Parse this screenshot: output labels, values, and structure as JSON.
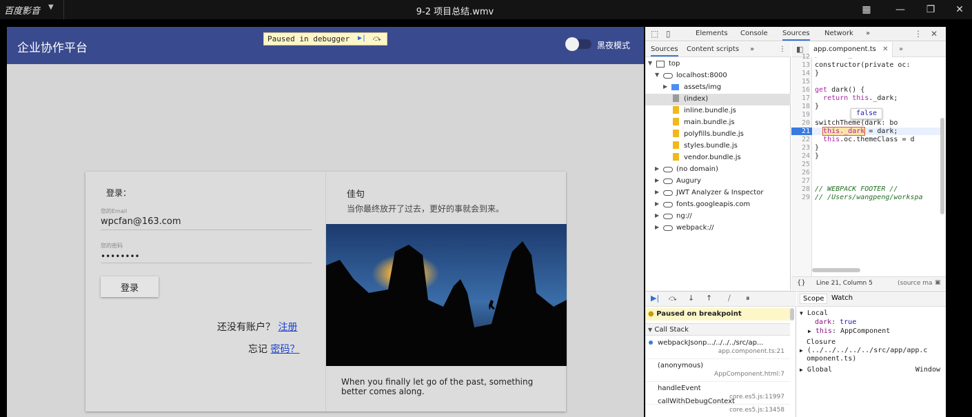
{
  "player": {
    "app_name": "百度影音",
    "video_title": "9-2 项目总结.wmv"
  },
  "app": {
    "title": "企业协作平台",
    "dark_mode_label": "黑夜模式",
    "debugger_banner": "Paused in debugger",
    "login": {
      "title": "登录：",
      "email_label": "您的Email",
      "email_value": "wpcfan@163.com",
      "password_label": "您的密码",
      "password_value": "••••••••",
      "login_button": "登录",
      "no_account_text": "还没有账户？",
      "register_link": "注册",
      "forgot_text": "忘记",
      "password_link": "密码？"
    },
    "quote": {
      "title": "佳句",
      "chinese": "当你最终放开了过去，更好的事就会到来。",
      "english": "When you finally let go of the past, something better comes along."
    }
  },
  "devtools": {
    "tabs": [
      "Elements",
      "Console",
      "Sources",
      "Network"
    ],
    "more": "»",
    "nav_tabs": [
      "Sources",
      "Content scripts"
    ],
    "tree": [
      {
        "label": "top"
      },
      {
        "label": "localhost:8000"
      },
      {
        "label": "assets/img"
      },
      {
        "label": "(index)"
      },
      {
        "label": "inline.bundle.js"
      },
      {
        "label": "main.bundle.js"
      },
      {
        "label": "polyfills.bundle.js"
      },
      {
        "label": "styles.bundle.js"
      },
      {
        "label": "vendor.bundle.js"
      },
      {
        "label": "(no domain)"
      },
      {
        "label": "Augury"
      },
      {
        "label": "JWT Analyzer & Inspector"
      },
      {
        "label": "fonts.googleapis.com"
      },
      {
        "label": "ng://"
      },
      {
        "label": "webpack://"
      }
    ],
    "editor_tab": "app.component.ts",
    "line_numbers": [
      "12",
      "13",
      "14",
      "15",
      "16",
      "17",
      "18",
      "19",
      "20",
      "21",
      "22",
      "23",
      "24",
      "25",
      "26",
      "27",
      "28",
      "29"
    ],
    "tooltip_value": "false",
    "status": "Line 21, Column 5",
    "status_right": "(source ma",
    "paused_on_breakpoint": "Paused on breakpoint",
    "call_stack_header": "Call Stack",
    "call_stack": [
      {
        "fn": "webpackJsonp.../../../../src/ap...",
        "loc": "app.component.ts:21"
      },
      {
        "fn": "(anonymous)",
        "loc": "AppComponent.html:7"
      },
      {
        "fn": "handleEvent",
        "loc": "core.es5.js:11997"
      },
      {
        "fn": "callWithDebugContext",
        "loc": "core.es5.js:13458"
      }
    ],
    "scope_tabs": [
      "Scope",
      "Watch"
    ],
    "scope": {
      "local": "Local",
      "dark_key": "dark",
      "dark_value": "true",
      "this_key": "this",
      "this_value": "AppComponent",
      "closure": "Closure",
      "closure_path_1": "(../../../../../src/app/app.c",
      "closure_path_2": "omponent.ts)",
      "global": "Global",
      "global_value": "Window"
    }
  }
}
